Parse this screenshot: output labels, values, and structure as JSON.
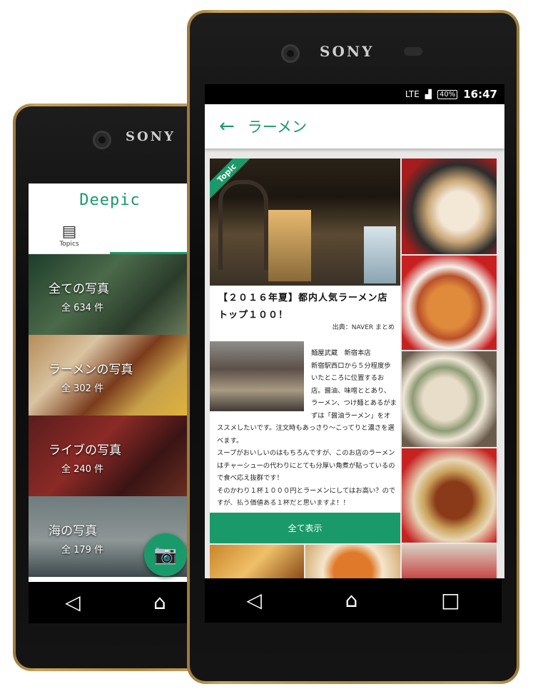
{
  "back_phone": {
    "brand": "SONY",
    "app_title": "Deepic",
    "tabs": [
      {
        "label": "Topics",
        "icon": "list-grid-icon",
        "selected": false
      }
    ],
    "categories": [
      {
        "label": "全ての写真",
        "count": "全 634 件"
      },
      {
        "label": "ラーメンの写真",
        "count": "全 302 件"
      },
      {
        "label": "ライブの写真",
        "count": "全 240 件"
      },
      {
        "label": "海の写真",
        "count": "全 179 件"
      }
    ],
    "fab_icon": "camera-icon"
  },
  "front_phone": {
    "brand": "SONY",
    "status": {
      "network": "LTE",
      "battery": "40%",
      "time": "16:47"
    },
    "appbar": {
      "title": "ラーメン",
      "back_icon": "arrow-left-icon"
    },
    "card": {
      "ribbon": "Topic",
      "title": "【２０１６年夏】都内人気ラーメン店トップ１００！",
      "source": "出典：NAVER まとめ",
      "body": "麺屋武蔵　新宿本店\n新宿駅西口から５分程度歩いたところに位置するお店。醤油、味噌ととあり、ラーメン、つけ麺とあるがまずは「醤油ラーメン」をオススメしたいです。注文時もあっさり～こってりと濃さを選べます。\nスープがおいしいのはもちろんですが、このお店のラーメンはチャーシューの代わりにとても分厚い角煮が貼っているので食べ応え抜群です！\nそのかわり１杯１０００円とラーメンにしてはお高い？のですが、払う価値ある１杯だと思いますよ！！",
      "show_all": "全て表示"
    }
  },
  "nav_icons": [
    "back-triangle-icon",
    "home-icon",
    "recents-square-icon"
  ]
}
